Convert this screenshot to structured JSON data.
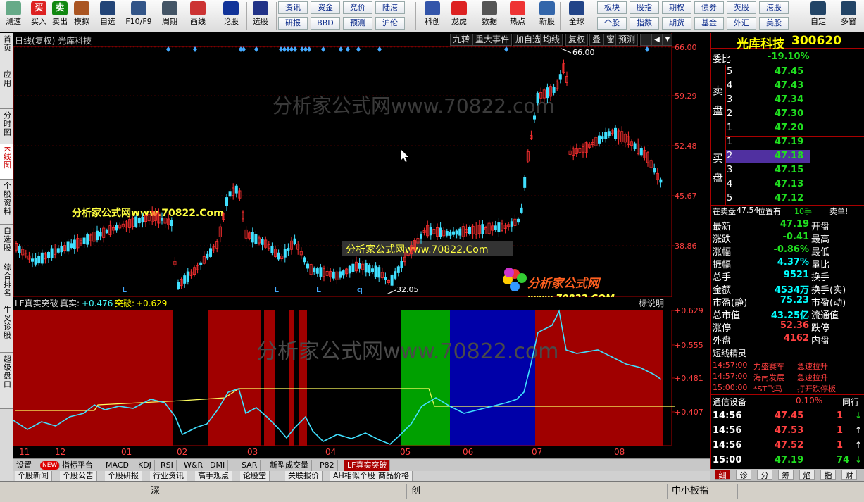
{
  "toolbar": {
    "items": [
      {
        "label": "测速",
        "icon": "speed-icon",
        "color": "#6a8"
      },
      {
        "label": "买入",
        "icon": "buy-icon",
        "color": "#d22",
        "glyph": "买"
      },
      {
        "label": "卖出",
        "icon": "sell-icon",
        "color": "#181",
        "glyph": "卖"
      },
      {
        "label": "模拟",
        "icon": "hammer-icon",
        "color": "#a52"
      },
      {
        "label": "自选",
        "icon": "star-icon",
        "color": "#247"
      },
      {
        "label": "F10/F9",
        "icon": "f10-icon",
        "color": "#358"
      },
      {
        "label": "周期",
        "icon": "clock-icon",
        "color": "#456"
      },
      {
        "label": "画线",
        "icon": "pen-icon",
        "color": "#c33"
      },
      {
        "label": "论股",
        "icon": "discuss-icon",
        "color": "#139"
      },
      {
        "label": "选股",
        "icon": "select-icon",
        "color": "#238"
      },
      {
        "label": "科创",
        "icon": "chart-icon",
        "color": "#35a"
      },
      {
        "label": "龙虎",
        "icon": "dragon-icon",
        "color": "#d22"
      },
      {
        "label": "数据",
        "icon": "data-icon",
        "color": "#555"
      },
      {
        "label": "热点",
        "icon": "hot-icon",
        "color": "#e33"
      },
      {
        "label": "新股",
        "icon": "newstock-icon",
        "color": "#36a"
      },
      {
        "label": "全球",
        "icon": "globe-icon",
        "color": "#248"
      },
      {
        "label": "自定",
        "icon": "custom-icon",
        "color": "#246"
      },
      {
        "label": "多窗",
        "icon": "multiwindow-icon",
        "color": "#246"
      }
    ],
    "menu_buttons": [
      [
        "资讯",
        "资金",
        "竞价",
        "陆港"
      ],
      [
        "研报",
        "BBD",
        "预测",
        "沪伦"
      ],
      [
        "板块",
        "股指",
        "期权",
        "债券",
        "英股",
        "港股"
      ],
      [
        "个股",
        "指数",
        "期货",
        "基金",
        "外汇",
        "美股"
      ]
    ]
  },
  "left_tabs": [
    "首页",
    "应用",
    "分时图",
    "K线图",
    "个股资料",
    "自选股",
    "综合排名",
    "牛叉诊股",
    "超级盘口"
  ],
  "kline": {
    "title": "日线(复权) 光库科技",
    "buttons": [
      "九转",
      "重大事件",
      "加自选",
      "均线",
      "复权",
      "叠",
      "窗",
      "预测"
    ],
    "price_ticks": [
      "66.00",
      "59.29",
      "52.48",
      "45.67",
      "38.86"
    ],
    "high_label": "66.00",
    "low_label": "32.05",
    "watermark": "分析家公式网www.70822.com",
    "watermark_yellow": "分析家公式网www.70822.Com",
    "watermark_box": "分析家公式网www.70822.Com",
    "logo_text": "分析家公式网",
    "logo_url": "www.70822.COM",
    "markers": [
      "L",
      "L",
      "L",
      "q"
    ]
  },
  "indicator": {
    "title": "LF真实突破",
    "label_real": "真实:",
    "value_real": "+0.476",
    "label_break": "突破:",
    "value_break": "+0.629",
    "help": "标说明",
    "ticks": [
      "+0.629",
      "+0.555",
      "+0.481",
      "+0.407"
    ]
  },
  "x_axis": [
    "11",
    "12",
    "01",
    "02",
    "03",
    "04",
    "05",
    "06",
    "07",
    "08"
  ],
  "bottom_tabs": [
    "设置",
    "NEW",
    "指标平台",
    "MACD",
    "KDJ",
    "RSI",
    "W&R",
    "DMI",
    "SAR",
    "新型成交量",
    "P82",
    "LF真实突破"
  ],
  "news_tabs": [
    "个股新闻",
    "个股公告",
    "个股研报",
    "行业资讯",
    "高手观点",
    "论股堂",
    "关联报价",
    "AH相似个股",
    "商品价格"
  ],
  "right": {
    "name": "光库科技",
    "code": "300620",
    "webi_label": "委比",
    "webi": "-19.10%",
    "sell_label": "卖盘",
    "buy_label": "买盘",
    "sell": [
      [
        "5",
        "47.45"
      ],
      [
        "4",
        "47.43"
      ],
      [
        "3",
        "47.34"
      ],
      [
        "2",
        "47.30"
      ],
      [
        "1",
        "47.20"
      ]
    ],
    "buy": [
      [
        "1",
        "47.19"
      ],
      [
        "2",
        "47.18"
      ],
      [
        "3",
        "47.15"
      ],
      [
        "4",
        "47.13"
      ],
      [
        "5",
        "47.12"
      ]
    ],
    "notice": {
      "prefix": "在卖盘",
      "price": "47.54",
      "mid": "位置有",
      "qty": "10手",
      "action": "卖单!"
    },
    "stats": [
      [
        "最新",
        "47.19",
        "开盘"
      ],
      [
        "涨跌",
        "-0.41",
        "最高"
      ],
      [
        "涨幅",
        "-0.86%",
        "最低"
      ],
      [
        "振幅",
        "4.37%",
        "量比"
      ],
      [
        "总手",
        "9521",
        "换手"
      ],
      [
        "金额",
        "4534万",
        "换手(实)"
      ],
      [
        "市盈(静)",
        "75.23",
        "市盈(动)"
      ],
      [
        "总市值",
        "43.25亿",
        "流通值"
      ],
      [
        "涨停",
        "52.36",
        "跌停"
      ],
      [
        "外盘",
        "4162",
        "内盘"
      ]
    ],
    "short_title": "短线精灵",
    "short": [
      [
        "14:57:00",
        "力盛赛车",
        "急速拉升"
      ],
      [
        "14:57:00",
        "海南发展",
        "急速拉升"
      ],
      [
        "15:00:00",
        "*ST飞马",
        "打开跌停板"
      ]
    ],
    "industry": "通信设备",
    "industry_pct": "0.10%",
    "industry_tag": "同行",
    "ticks": [
      [
        "14:56",
        "47.45",
        "1"
      ],
      [
        "14:56",
        "47.53",
        "1"
      ],
      [
        "14:56",
        "47.52",
        "1"
      ],
      [
        "15:00",
        "47.19",
        "74"
      ]
    ],
    "tabs": [
      "细",
      "诊",
      "分",
      "筹",
      "焰",
      "指",
      "财"
    ]
  },
  "status": [
    "深",
    "创",
    "中小板指"
  ]
}
